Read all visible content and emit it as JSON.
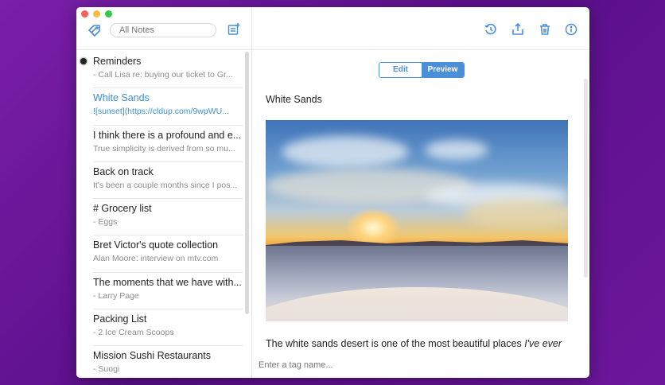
{
  "sidebar": {
    "search_placeholder": "All Notes",
    "notes": [
      {
        "title": "Reminders",
        "snippet": "- Call Lisa re: buying our ticket to Gr..."
      },
      {
        "title": "White Sands",
        "snippet": "![sunset](https://cldup.com/9wpWU..."
      },
      {
        "title": "I think there is a profound and e...",
        "snippet": "True simplicity is derived from so mu..."
      },
      {
        "title": "Back on track",
        "snippet": "It's been a couple months since I pos..."
      },
      {
        "title": "# Grocery list",
        "snippet": "- Eggs"
      },
      {
        "title": "Bret Victor's quote collection",
        "snippet": "Alan Moore: interview on mtv.com"
      },
      {
        "title": "The moments that we have with...",
        "snippet": "- Larry Page"
      },
      {
        "title": "Packing List",
        "snippet": "- 2 Ice Cream Scoops"
      },
      {
        "title": "Mission Sushi Restaurants",
        "snippet": "- Suogi"
      }
    ]
  },
  "editor": {
    "edit_label": "Edit",
    "preview_label": "Preview",
    "note_title": "White Sands",
    "body_text": "The white sands desert is one of the most beautiful places ",
    "body_italic": "I've ever",
    "tag_placeholder": "Enter a tag name..."
  },
  "colors": {
    "accent": "#4a90d9"
  }
}
